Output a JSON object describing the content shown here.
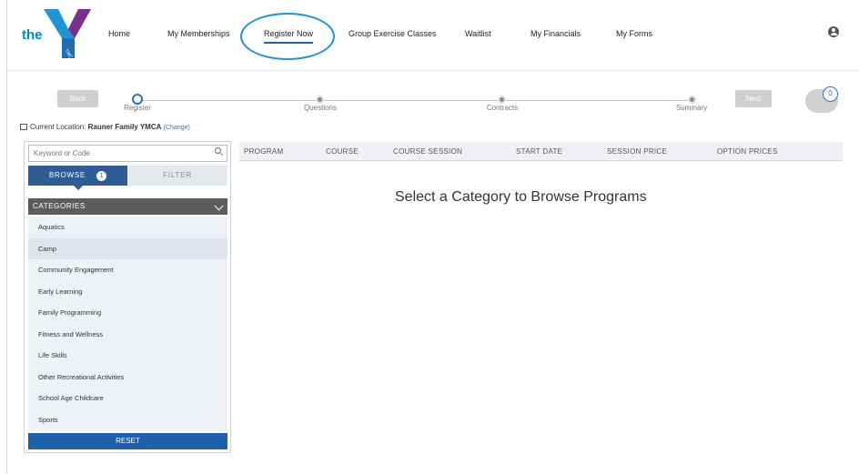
{
  "brand": {
    "logo_text": "the",
    "logo_sub": "YMCA",
    "colors": {
      "accent": "#2a73b8",
      "browse_tab": "#2c5d94",
      "reset": "#1e60aa"
    }
  },
  "nav": {
    "items": [
      {
        "label": "Home"
      },
      {
        "label": "My Memberships"
      },
      {
        "label": "Register Now"
      },
      {
        "label": "Group Exercise Classes"
      },
      {
        "label": "Waitlist"
      },
      {
        "label": "My Financials"
      },
      {
        "label": "My Forms"
      }
    ],
    "active": "Register Now",
    "user_icon": "user-circle-icon"
  },
  "stepper": {
    "back_label": "Back",
    "next_label": "Next",
    "steps": [
      {
        "label": "Register"
      },
      {
        "label": "Questions"
      },
      {
        "label": "Contracts"
      },
      {
        "label": "Summary"
      }
    ],
    "current_step": "Register",
    "cart_count": "0"
  },
  "location": {
    "prefix": "Current Location:",
    "name": "Rauner Family YMCA",
    "change_label": "(Change)"
  },
  "sidebar": {
    "search_placeholder": "Keyword or Code",
    "browse_label": "BROWSE",
    "browse_badge": "1",
    "filter_label": "FILTER",
    "categories_label": "CATEGORIES",
    "categories": [
      {
        "label": "Aquatics"
      },
      {
        "label": "Camp"
      },
      {
        "label": "Community Engagement"
      },
      {
        "label": "Early Learning"
      },
      {
        "label": "Family Programming"
      },
      {
        "label": "Fitness and Wellness"
      },
      {
        "label": "Life Skills"
      },
      {
        "label": "Other Recreational Activities"
      },
      {
        "label": "School Age Childcare"
      },
      {
        "label": "Sports"
      }
    ],
    "hovered_category": "Camp",
    "reset_label": "RESET"
  },
  "table": {
    "columns": [
      {
        "label": "PROGRAM"
      },
      {
        "label": "COURSE"
      },
      {
        "label": "COURSE SESSION"
      },
      {
        "label": "START DATE"
      },
      {
        "label": "SESSION PRICE"
      },
      {
        "label": "OPTION PRICES"
      }
    ],
    "empty_message": "Select a Category to Browse Programs"
  }
}
